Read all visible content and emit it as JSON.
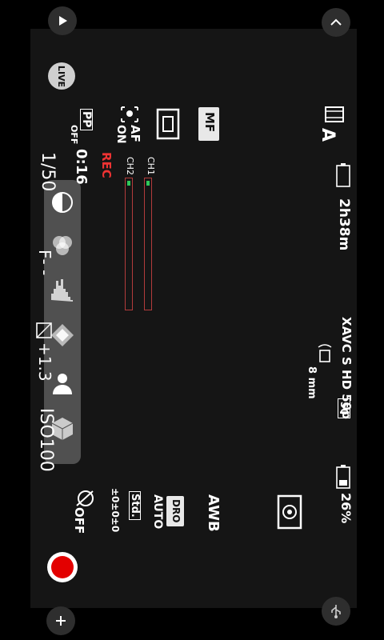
{
  "status": {
    "movie_mode": "A",
    "battery_time": "2h38m",
    "format": "XAVC S HD 50p",
    "format_badge": "50",
    "steady_shot": "8 mm",
    "battery_percent": "26%"
  },
  "settings": {
    "focus_mode": "MF",
    "pp": "PP",
    "pp_value": "OFF",
    "time": "0:16",
    "af": "AF",
    "af_value": "ON",
    "rec": "REC",
    "ch1": "CH1",
    "ch2": "CH2",
    "white_balance": "AWB",
    "dro": "DRO",
    "dro_value": "AUTO",
    "creative_style": "Std.",
    "creative_values": "±0±0±0",
    "picture_effect": "OFF"
  },
  "exposure": {
    "shutter": "1/50",
    "aperture": "F- -",
    "exposure_comp": "+1.3",
    "iso": "ISO100"
  },
  "live_label": "LIVE",
  "colors": {
    "rec": "#e30000",
    "meter_level": "#2ec95a",
    "meter_border": "#b23b3b"
  },
  "icons": [
    "play-icon",
    "chevron-up-icon",
    "plus-icon",
    "usb-icon",
    "live-icon",
    "contrast-icon",
    "color-circles-icon",
    "histogram-icon",
    "gradation-icon",
    "portrait-icon",
    "cube-icon",
    "movie-icon",
    "battery-icon",
    "focus-area-icon",
    "metering-icon",
    "record-icon"
  ]
}
